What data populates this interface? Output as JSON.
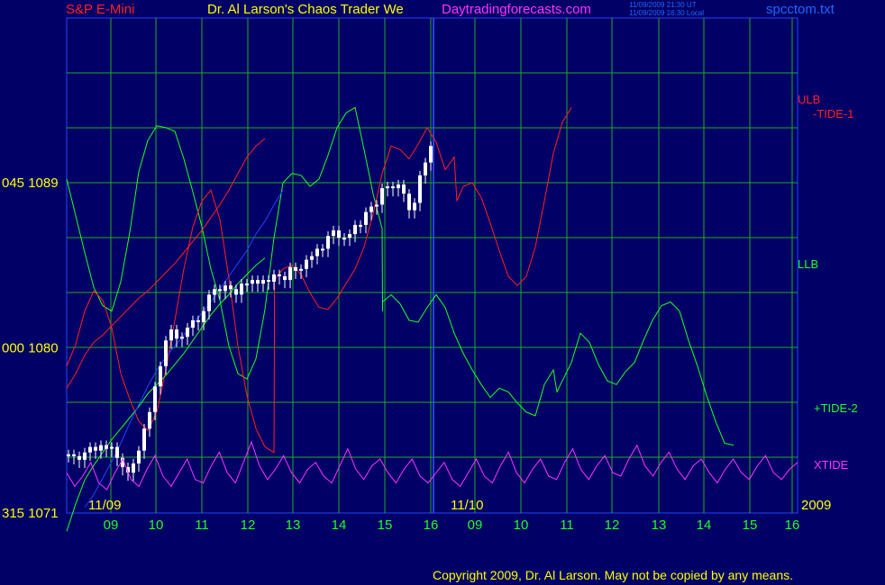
{
  "header": {
    "symbol": "S&P E-Mini",
    "title": "Dr. Al Larson's Chaos Trader We",
    "site": "Daytradingforecasts.com",
    "timestamp_ut": "11/09/2009 21:30 UT",
    "timestamp_local": "11/09/2009 16:30 Local",
    "filename": "spcctom.txt"
  },
  "footer": {
    "copyright": "Copyright 2009, Dr. Al Larson. May not be copied by any means."
  },
  "colors": {
    "background": "#000066",
    "grid": "#22aa22",
    "price": "#ffffff",
    "ulb": "#ff2020",
    "llb": "#20ff20",
    "xtide": "#ff33ff",
    "avg": "#2244ff",
    "yellow": "#ffff00"
  },
  "chart_data": {
    "type": "line",
    "y_labels": [
      {
        "code": "045",
        "price": "1089",
        "value": 1089
      },
      {
        "code": "000",
        "price": "1080",
        "value": 1080
      },
      {
        "code": "315",
        "price": "1071",
        "value": 1071
      }
    ],
    "ylim": [
      1071,
      1089
    ],
    "date_labels": [
      "11/09",
      "11/10",
      "2009"
    ],
    "hour_ticks": [
      "09",
      "10",
      "11",
      "12",
      "13",
      "14",
      "15",
      "16",
      "09",
      "10",
      "11",
      "12",
      "13",
      "14",
      "15",
      "16"
    ],
    "grid": true,
    "series_labels": [
      "ULB",
      "-TIDE-1",
      "LLB",
      "+TIDE-2",
      "XTIDE"
    ],
    "price_closes": [
      1074.1,
      1074.0,
      1073.8,
      1074.2,
      1074.5,
      1074.3,
      1074.6,
      1074.4,
      1074.5,
      1073.9,
      1073.4,
      1073.1,
      1073.6,
      1074.3,
      1075.5,
      1076.4,
      1077.8,
      1078.9,
      1080.3,
      1080.9,
      1080.4,
      1080.5,
      1081.0,
      1081.4,
      1081.3,
      1081.9,
      1082.8,
      1083.1,
      1083.0,
      1083.3,
      1083.1,
      1082.8,
      1083.4,
      1083.4,
      1083.6,
      1083.4,
      1083.6,
      1083.5,
      1083.9,
      1083.8,
      1083.6,
      1084.3,
      1084.1,
      1084.2,
      1084.7,
      1084.9,
      1085.3,
      1085.3,
      1086.0,
      1086.3,
      1085.9,
      1085.9,
      1086.1,
      1086.6,
      1086.6,
      1087.3,
      1087.6,
      1087.7,
      1088.6,
      1088.7,
      1088.6,
      1088.8,
      1088.3,
      1087.4,
      1087.8,
      1089.3,
      1090.0,
      1090.9
    ],
    "ulb": [
      [
        0,
        1077.8
      ],
      [
        1,
        1078.6
      ],
      [
        2,
        1079.6
      ],
      [
        3,
        1080.3
      ],
      [
        4,
        1080.7
      ],
      [
        5,
        1081.2
      ],
      [
        6,
        1081.7
      ],
      [
        7,
        1082.2
      ],
      [
        8,
        1082.7
      ],
      [
        9,
        1083.1
      ],
      [
        10,
        1083.6
      ],
      [
        11,
        1084.1
      ],
      [
        12,
        1084.6
      ],
      [
        13,
        1085.2
      ],
      [
        14,
        1085.8
      ],
      [
        15,
        1086.4
      ],
      [
        16,
        1087.1
      ],
      [
        17,
        1087.8
      ],
      [
        18,
        1088.6
      ],
      [
        19,
        1089.5
      ],
      [
        20,
        1090.4
      ],
      [
        21,
        1091.0
      ],
      [
        22,
        1091.4
      ]
    ],
    "llb": [
      [
        0,
        1070.0
      ],
      [
        1,
        1071.5
      ],
      [
        2,
        1072.8
      ],
      [
        3,
        1073.6
      ],
      [
        4,
        1074.3
      ],
      [
        5,
        1075.0
      ],
      [
        6,
        1075.6
      ],
      [
        7,
        1076.2
      ],
      [
        8,
        1076.8
      ],
      [
        9,
        1077.5
      ],
      [
        10,
        1078.0
      ],
      [
        11,
        1078.5
      ],
      [
        12,
        1079.1
      ],
      [
        13,
        1079.7
      ],
      [
        14,
        1080.4
      ],
      [
        15,
        1081.1
      ],
      [
        16,
        1081.8
      ],
      [
        17,
        1082.4
      ],
      [
        18,
        1082.9
      ],
      [
        19,
        1083.5
      ],
      [
        20,
        1084.0
      ],
      [
        21,
        1084.5
      ],
      [
        22,
        1084.9
      ]
    ],
    "avg": [
      [
        2,
        1071.3
      ],
      [
        3,
        1072.0
      ],
      [
        4,
        1072.9
      ],
      [
        5,
        1073.8
      ],
      [
        6,
        1074.8
      ],
      [
        7,
        1075.9
      ],
      [
        8,
        1076.9
      ],
      [
        9,
        1077.9
      ],
      [
        10,
        1078.8
      ],
      [
        11,
        1079.5
      ],
      [
        12,
        1080.1
      ],
      [
        13,
        1080.7
      ],
      [
        14,
        1081.3
      ],
      [
        15,
        1081.9
      ],
      [
        16,
        1082.5
      ],
      [
        17,
        1083.2
      ],
      [
        18,
        1083.9
      ],
      [
        19,
        1084.6
      ],
      [
        20,
        1085.3
      ],
      [
        21,
        1086.2
      ],
      [
        22,
        1086.9
      ],
      [
        23,
        1087.8
      ],
      [
        24,
        1088.6
      ]
    ],
    "tide1": [
      [
        0,
        1079.0
      ],
      [
        1,
        1080.2
      ],
      [
        2,
        1082.0
      ],
      [
        3,
        1083.1
      ],
      [
        4,
        1082.6
      ],
      [
        5,
        1081.1
      ],
      [
        6,
        1078.6
      ],
      [
        7,
        1077.2
      ],
      [
        8,
        1076.0
      ],
      [
        9,
        1075.5
      ],
      [
        10,
        1076.5
      ],
      [
        11,
        1078.8
      ],
      [
        12,
        1081.5
      ],
      [
        13,
        1084.3
      ],
      [
        14,
        1086.6
      ],
      [
        15,
        1088.0
      ],
      [
        16,
        1088.6
      ],
      [
        17,
        1087.0
      ],
      [
        18,
        1083.8
      ],
      [
        19,
        1080.1
      ],
      [
        20,
        1077.4
      ],
      [
        21,
        1075.6
      ],
      [
        22,
        1074.6
      ],
      [
        23,
        1074.3
      ],
      [
        23.05,
        1080.8
      ],
      [
        23.05,
        1083.7
      ],
      [
        24,
        1084.3
      ],
      [
        25,
        1084.5
      ],
      [
        26,
        1084.0
      ],
      [
        27,
        1083.0
      ],
      [
        28,
        1082.2
      ],
      [
        29,
        1082.1
      ],
      [
        30,
        1082.7
      ],
      [
        31,
        1083.5
      ],
      [
        32,
        1084.3
      ],
      [
        33,
        1085.5
      ],
      [
        34,
        1087.3
      ],
      [
        35,
        1089.5
      ],
      [
        36,
        1091.0
      ],
      [
        37,
        1090.8
      ],
      [
        38,
        1090.3
      ],
      [
        39,
        1091.1
      ],
      [
        40,
        1092.0
      ],
      [
        41,
        1091.2
      ],
      [
        42,
        1089.7
      ],
      [
        43,
        1090.4
      ],
      [
        43.3,
        1088.0
      ],
      [
        44,
        1088.8
      ],
      [
        45,
        1089.0
      ],
      [
        46,
        1088.2
      ],
      [
        47,
        1086.8
      ],
      [
        48,
        1085.3
      ],
      [
        49,
        1083.9
      ],
      [
        50,
        1083.4
      ],
      [
        51,
        1083.9
      ],
      [
        52,
        1085.5
      ],
      [
        53,
        1088.0
      ],
      [
        54,
        1090.6
      ],
      [
        55,
        1092.3
      ],
      [
        56,
        1093.1
      ]
    ],
    "tide2": [
      [
        0,
        1089.2
      ],
      [
        1,
        1087.2
      ],
      [
        2,
        1085.2
      ],
      [
        3,
        1083.3
      ],
      [
        4,
        1082.3
      ],
      [
        5,
        1082.0
      ],
      [
        6,
        1083.6
      ],
      [
        7,
        1086.3
      ],
      [
        8,
        1089.6
      ],
      [
        9,
        1091.3
      ],
      [
        10,
        1092.1
      ],
      [
        11,
        1092.0
      ],
      [
        12,
        1091.8
      ],
      [
        13,
        1090.3
      ],
      [
        14,
        1088.5
      ],
      [
        15,
        1086.6
      ],
      [
        16,
        1084.3
      ],
      [
        17,
        1082.6
      ],
      [
        18,
        1080.1
      ],
      [
        19,
        1078.6
      ],
      [
        20,
        1078.3
      ],
      [
        21,
        1079.4
      ],
      [
        22,
        1082.1
      ],
      [
        23,
        1086.0
      ],
      [
        24,
        1089.0
      ],
      [
        25,
        1089.5
      ],
      [
        26,
        1089.4
      ],
      [
        27,
        1088.8
      ],
      [
        28,
        1089.2
      ],
      [
        29,
        1090.5
      ],
      [
        30,
        1092.0
      ],
      [
        31,
        1092.8
      ],
      [
        32,
        1093.1
      ],
      [
        33,
        1090.8
      ],
      [
        34,
        1088.4
      ],
      [
        35,
        1086.5
      ],
      [
        35.05,
        1082.0
      ],
      [
        35.05,
        1082.5
      ],
      [
        36,
        1082.9
      ],
      [
        37,
        1082.4
      ],
      [
        38,
        1081.5
      ],
      [
        39,
        1081.4
      ],
      [
        40,
        1082.2
      ],
      [
        41,
        1082.9
      ],
      [
        42,
        1082.2
      ],
      [
        43,
        1080.8
      ],
      [
        44,
        1079.7
      ],
      [
        45,
        1078.8
      ],
      [
        46,
        1078.0
      ],
      [
        47,
        1077.3
      ],
      [
        48,
        1077.8
      ],
      [
        49,
        1077.6
      ],
      [
        50,
        1077.0
      ],
      [
        51,
        1076.5
      ],
      [
        52,
        1076.3
      ],
      [
        53,
        1078.0
      ],
      [
        54,
        1078.8
      ],
      [
        54.4,
        1077.6
      ],
      [
        55,
        1078.2
      ],
      [
        56,
        1079.2
      ],
      [
        57,
        1080.8
      ],
      [
        58,
        1080.3
      ],
      [
        59,
        1079.1
      ],
      [
        60,
        1078.2
      ],
      [
        61,
        1078.0
      ],
      [
        62,
        1078.7
      ],
      [
        63,
        1079.2
      ],
      [
        64,
        1080.4
      ],
      [
        65,
        1081.5
      ],
      [
        66,
        1082.3
      ],
      [
        67,
        1082.5
      ],
      [
        68,
        1082.0
      ],
      [
        69,
        1080.4
      ],
      [
        70,
        1079.0
      ],
      [
        71,
        1077.4
      ],
      [
        72,
        1076.0
      ],
      [
        73,
        1074.8
      ],
      [
        74,
        1074.7
      ]
    ],
    "xtide": [
      0.6,
      0.2,
      0.5,
      0.9,
      0.3,
      0.1,
      0.6,
      1.0,
      0.4,
      0.2,
      0.7,
      1.1,
      0.5,
      0.2,
      0.6,
      1.0,
      0.4,
      0.3,
      0.8,
      1.2,
      0.6,
      0.3,
      0.9,
      1.5,
      0.8,
      0.4,
      0.7,
      1.1,
      0.6,
      0.3,
      0.7,
      0.9,
      0.5,
      0.3,
      0.8,
      1.3,
      0.7,
      0.4,
      0.8,
      1.0,
      0.6,
      0.3,
      0.7,
      1.0,
      0.5,
      0.3,
      0.6,
      0.9,
      0.4,
      0.2,
      0.6,
      1.0,
      0.5,
      0.3,
      0.8,
      1.2,
      0.6,
      0.3,
      0.7,
      1.0,
      0.5,
      0.4,
      0.9,
      1.3,
      0.7,
      0.4,
      0.8,
      1.1,
      0.6,
      0.5,
      1.0,
      1.4,
      0.8,
      0.5,
      0.9,
      1.2,
      0.7,
      0.4,
      0.8,
      1.0,
      0.6,
      0.3,
      0.7,
      1.0,
      0.6,
      0.4,
      0.8,
      1.1,
      0.6,
      0.4,
      0.7,
      0.9
    ]
  }
}
